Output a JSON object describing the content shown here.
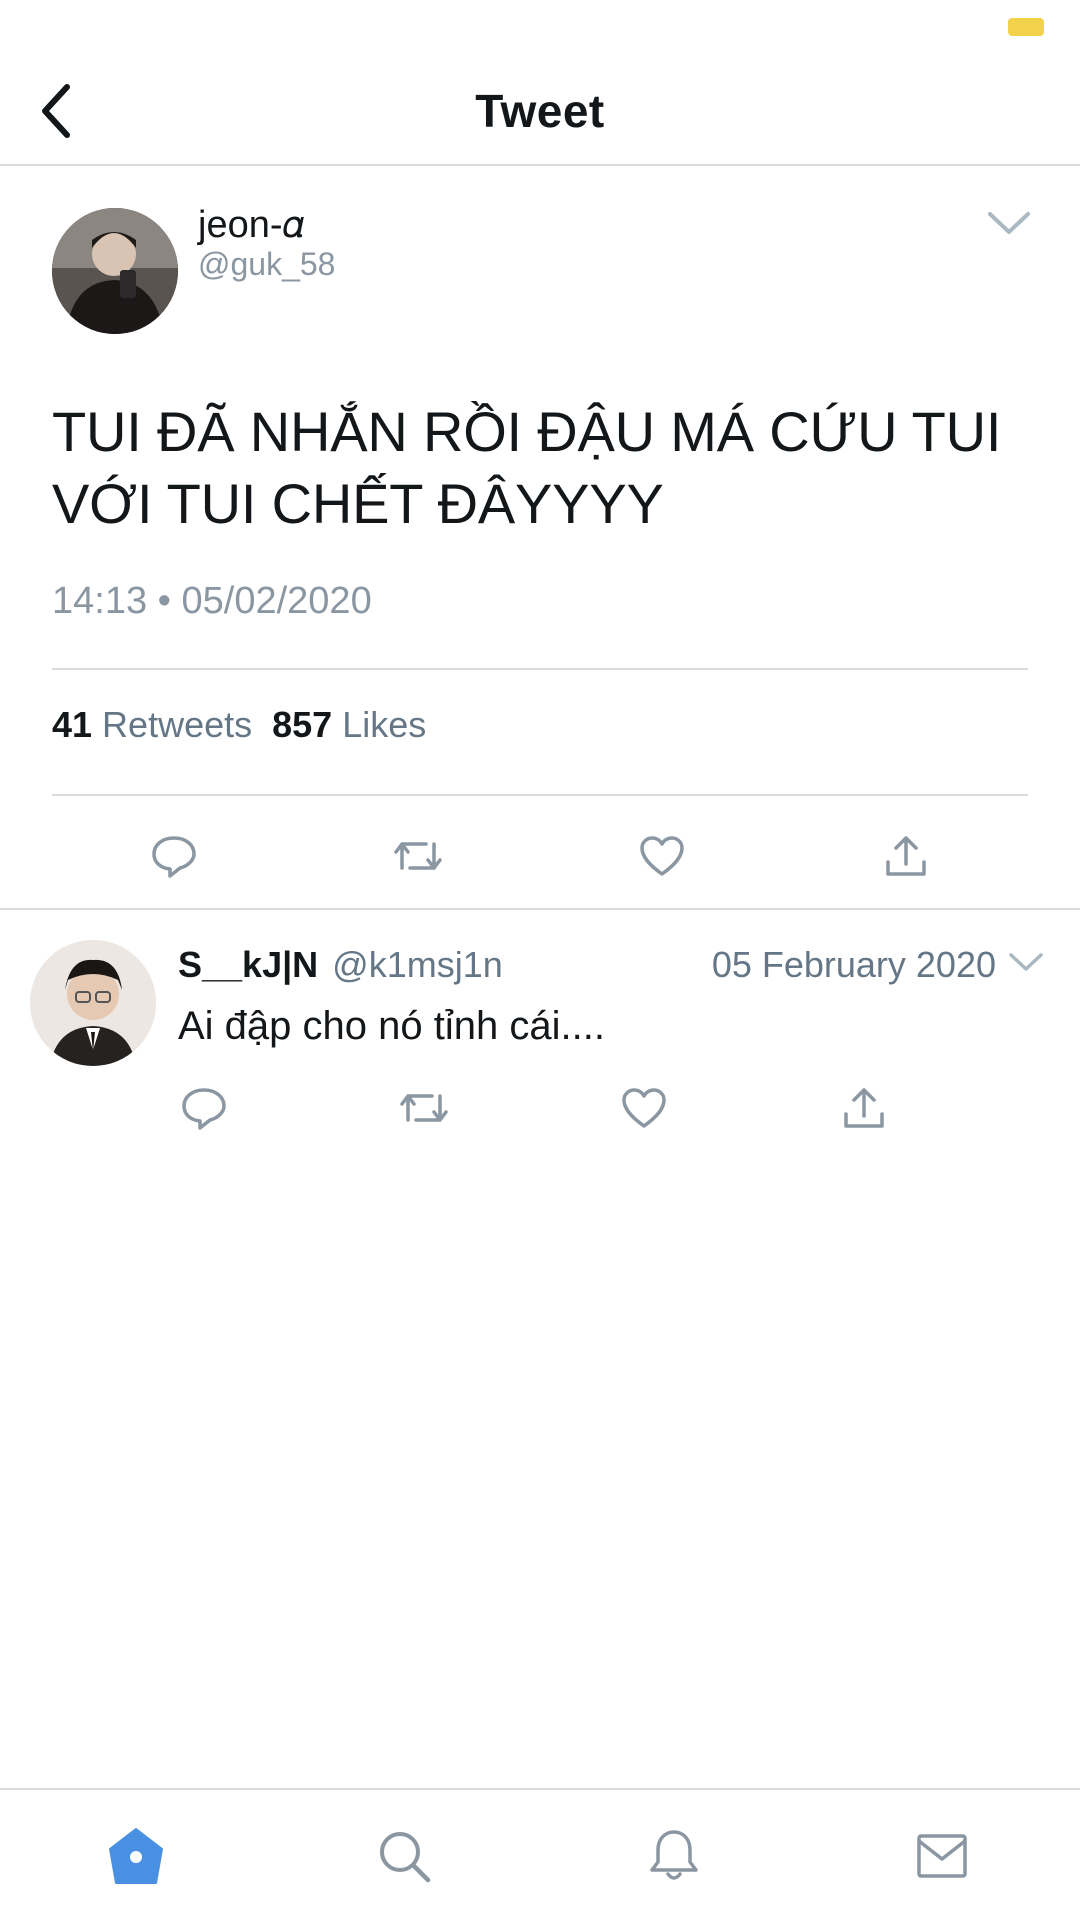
{
  "header": {
    "title": "Tweet",
    "back_icon": "chevron-left-icon"
  },
  "tweet": {
    "author_name": "jeon-𝛼",
    "author_handle": "@guk_58",
    "text": "TUI ĐÃ NHẮN RỒI ĐẬU MÁ CỨU TUI VỚI TUI CHẾT ĐÂYYYY",
    "timestamp": "14:13 • 05/02/2020",
    "retweets_count": "41",
    "retweets_label": "Retweets",
    "likes_count": "857",
    "likes_label": "Likes"
  },
  "reply": {
    "author_name": "S__kJ|N",
    "author_handle": "@k1msj1n",
    "date": "05 February 2020",
    "text": "Ai đập cho nó tỉnh cái...."
  },
  "actions": [
    "reply-icon",
    "retweet-icon",
    "like-icon",
    "share-icon"
  ],
  "tab_bar": [
    "home-icon",
    "search-icon",
    "notifications-icon",
    "messages-icon"
  ],
  "colors": {
    "accent": "#4a90e2",
    "icon_gray": "#8a96a1",
    "battery": "#f2d24b",
    "divider": "#d6dbe0"
  }
}
